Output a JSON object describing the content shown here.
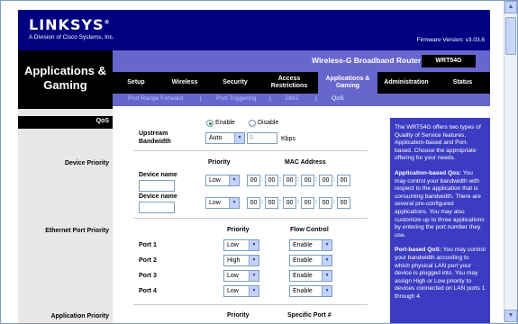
{
  "header": {
    "logo": "LINKSYS",
    "logo_mark": "®",
    "logo_sub": "A Division of Cisco Systems, Inc.",
    "firmware": "Firmware Version: v3.03.6"
  },
  "section_title": "Applications & Gaming",
  "band_title": "Wireless-G Broadband Router",
  "model": "WRT54G",
  "tabs": [
    "Setup",
    "Wireless",
    "Security",
    "Access Restrictions",
    "Applications & Gaming",
    "Administration",
    "Status"
  ],
  "subtabs": [
    "Port Range Forward",
    "Port Triggering",
    "DMZ",
    "QoS"
  ],
  "left_labels": {
    "qos": "QoS",
    "device_priority": "Device Priority",
    "ethernet_priority": "Ethernet Port Priority",
    "application_priority": "Application Priority"
  },
  "qos": {
    "enable": "Enable",
    "disable": "Disable",
    "upstream_label": "Upstream Bandwidth",
    "upstream_value": "Auto",
    "upstream_input": "0",
    "unit": "Kbps"
  },
  "device": {
    "col_priority": "Priority",
    "col_mac": "MAC Address",
    "rows": [
      {
        "label": "Device name",
        "priority": "Low",
        "mac": [
          "00",
          "00",
          "00",
          "00",
          "00",
          "00"
        ]
      },
      {
        "label": "Device name",
        "priority": "Low",
        "mac": [
          "00",
          "00",
          "00",
          "00",
          "00",
          "00"
        ]
      }
    ]
  },
  "ethernet": {
    "col_priority": "Priority",
    "col_flow": "Flow Control",
    "rows": [
      {
        "label": "Port 1",
        "priority": "Low",
        "flow": "Enable"
      },
      {
        "label": "Port 2",
        "priority": "High",
        "flow": "Enable"
      },
      {
        "label": "Port 3",
        "priority": "Low",
        "flow": "Enable"
      },
      {
        "label": "Port 4",
        "priority": "Low",
        "flow": "Enable"
      }
    ]
  },
  "application": {
    "col_priority": "Priority",
    "col_port": "Specific Port #"
  },
  "help": {
    "p1": "The WRT54G offers two types of Quality of Service features, Application-based and Port-based. Choose the appropriate offering for your needs.",
    "p2_title": "Application-based Qos:",
    "p2": " You may control your bandwidth with respect to the application that is consuming bandwidth. There are several pre-configured applications. You may also customize up to three applications by entering the port number they use.",
    "p3_title": "Port-based QoS:",
    "p3": " You may control your bandwidth according to which physical LAN port your device is plugged into. You may assign High or Low priority to devices connected on LAN ports 1 through 4."
  },
  "colors": {
    "navy": "#000080",
    "purple": "#6666cc",
    "help_bg": "#3c3cc3"
  }
}
